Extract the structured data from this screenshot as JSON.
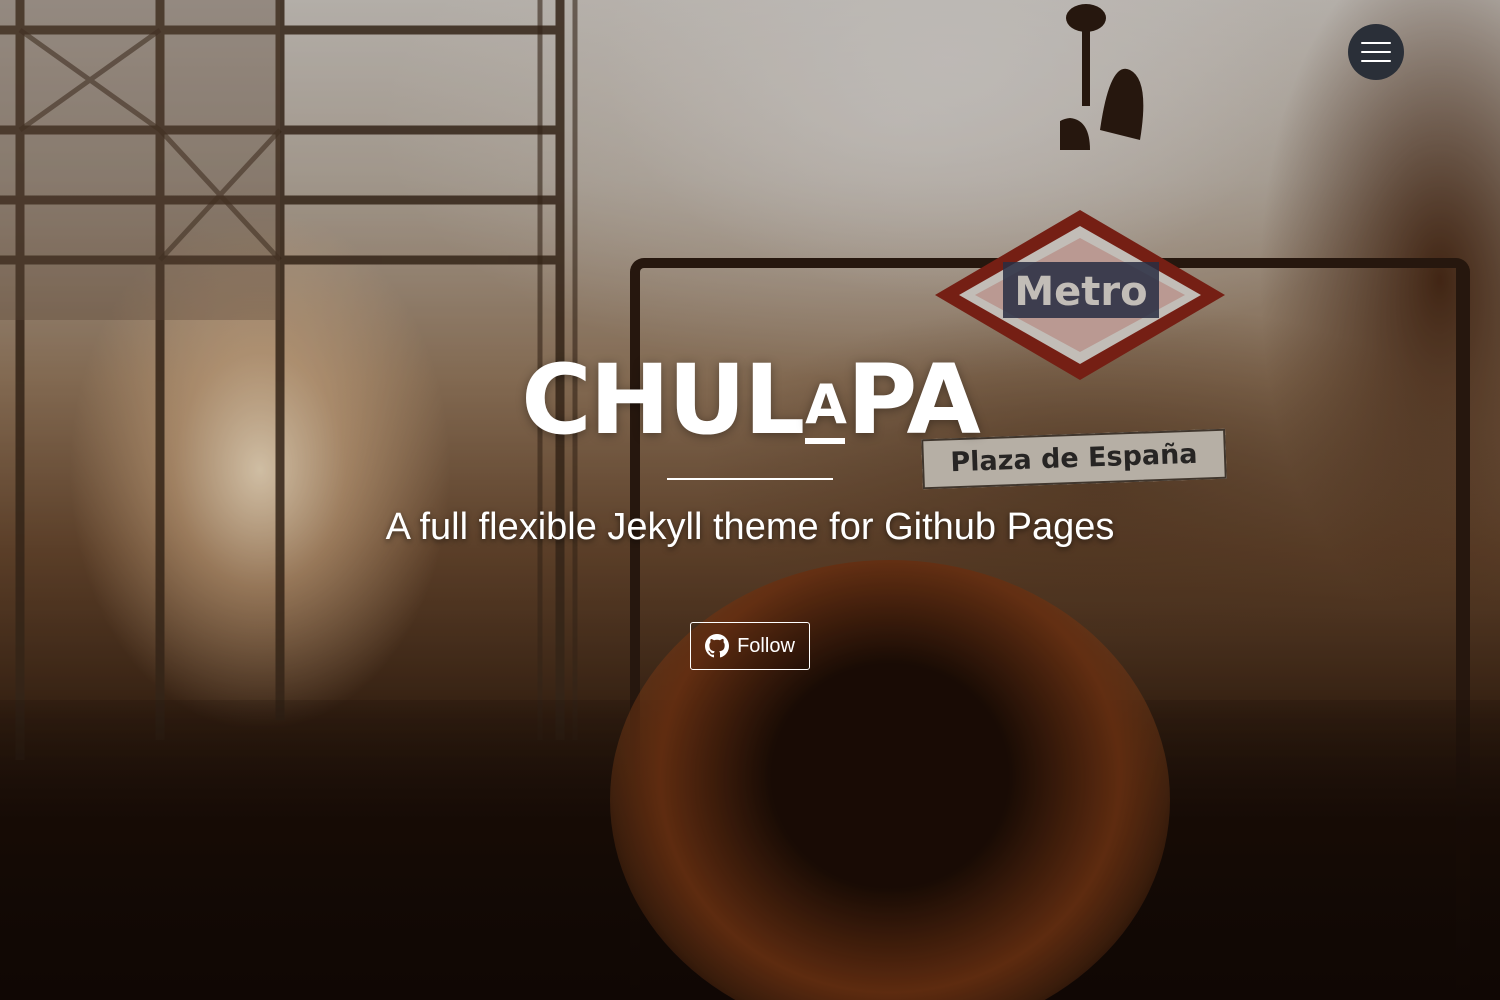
{
  "header": {
    "menu_icon": "hamburger-menu-icon",
    "menu_button_color": "#2a2f38"
  },
  "hero": {
    "background_scene_text": {
      "metro_sign": "Metro",
      "street_sign": "Plaza de España"
    },
    "logo": {
      "part1": "CHUL",
      "small_letter": "A",
      "part2": "PA"
    },
    "tagline": "A full flexible Jekyll theme for Github Pages",
    "follow_button": {
      "label": "Follow",
      "icon": "github-icon"
    }
  },
  "colors": {
    "text": "#ffffff",
    "overlay": "#1a1008"
  }
}
